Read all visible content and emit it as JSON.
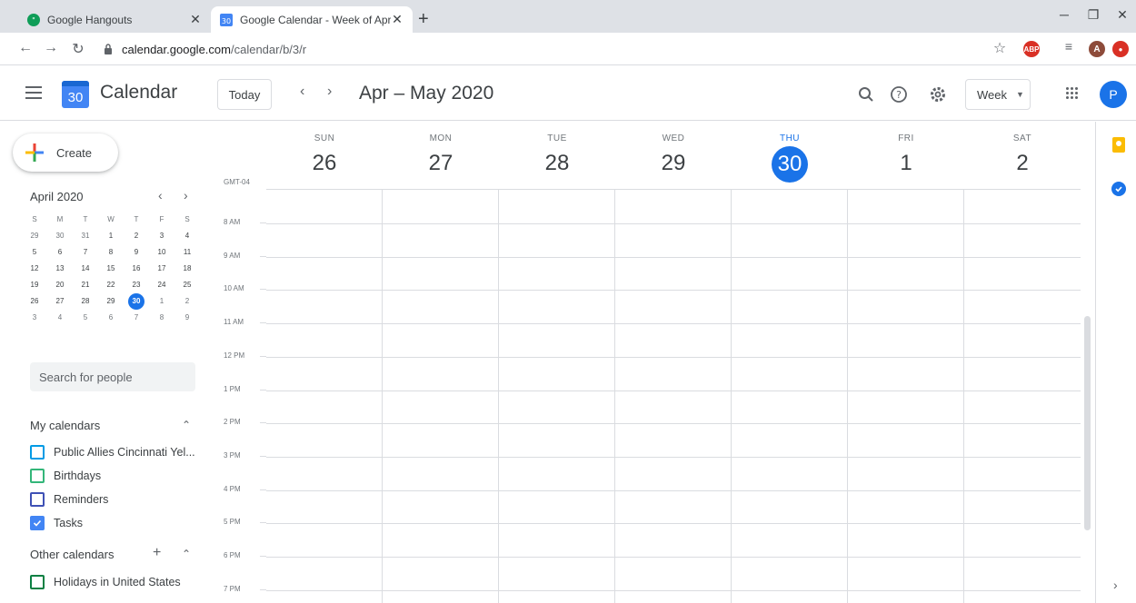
{
  "browser": {
    "tabs": [
      {
        "title": "Google Hangouts",
        "active": false
      },
      {
        "title": "Google Calendar - Week of April",
        "active": true
      }
    ],
    "favicon_text": "30",
    "url_host": "calendar.google.com",
    "url_path": "/calendar/b/3/r",
    "profile_initial": "A",
    "adblock_label": "ABP"
  },
  "header": {
    "app_name": "Calendar",
    "logo_day": "30",
    "today_label": "Today",
    "range_title": "Apr – May 2020",
    "view_label": "Week",
    "avatar_initial": "P"
  },
  "sidebar": {
    "create_label": "Create",
    "mini_calendar": {
      "title": "April 2020",
      "weekdays": [
        "S",
        "M",
        "T",
        "W",
        "T",
        "F",
        "S"
      ],
      "weeks": [
        [
          "29",
          "30",
          "31",
          "1",
          "2",
          "3",
          "4"
        ],
        [
          "5",
          "6",
          "7",
          "8",
          "9",
          "10",
          "11"
        ],
        [
          "12",
          "13",
          "14",
          "15",
          "16",
          "17",
          "18"
        ],
        [
          "19",
          "20",
          "21",
          "22",
          "23",
          "24",
          "25"
        ],
        [
          "26",
          "27",
          "28",
          "29",
          "30",
          "1",
          "2"
        ],
        [
          "3",
          "4",
          "5",
          "6",
          "7",
          "8",
          "9"
        ]
      ]
    },
    "search_placeholder": "Search for people",
    "my_calendars_title": "My calendars",
    "my_calendars": [
      {
        "name": "Public Allies Cincinnati Yel...",
        "color": "#039be5",
        "checked": false
      },
      {
        "name": "Birthdays",
        "color": "#33b679",
        "checked": false
      },
      {
        "name": "Reminders",
        "color": "#3f51b5",
        "checked": false
      },
      {
        "name": "Tasks",
        "color": "#4285f4",
        "checked": true
      }
    ],
    "other_calendars_title": "Other calendars",
    "other_calendars": [
      {
        "name": "Holidays in United States",
        "color": "#0b8043",
        "checked": false
      }
    ]
  },
  "week": {
    "timezone": "GMT-04",
    "days": [
      {
        "name": "SUN",
        "num": "26",
        "today": false
      },
      {
        "name": "MON",
        "num": "27",
        "today": false
      },
      {
        "name": "TUE",
        "num": "28",
        "today": false
      },
      {
        "name": "WED",
        "num": "29",
        "today": false
      },
      {
        "name": "THU",
        "num": "30",
        "today": true
      },
      {
        "name": "FRI",
        "num": "1",
        "today": false
      },
      {
        "name": "SAT",
        "num": "2",
        "today": false
      }
    ],
    "hours": [
      "8 AM",
      "9 AM",
      "10 AM",
      "11 AM",
      "12 PM",
      "1 PM",
      "2 PM",
      "3 PM",
      "4 PM",
      "5 PM",
      "6 PM",
      "7 PM"
    ]
  },
  "colors": {
    "accent": "#1a73e8",
    "gridline": "#dadce0"
  }
}
